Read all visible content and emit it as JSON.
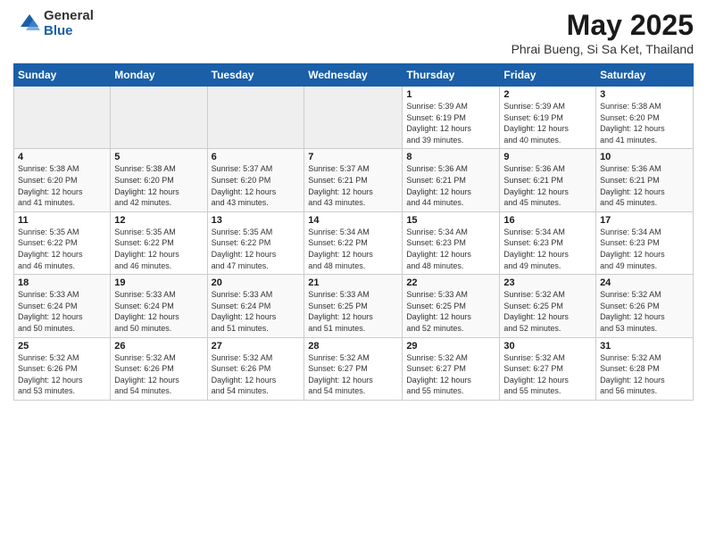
{
  "logo": {
    "general": "General",
    "blue": "Blue"
  },
  "header": {
    "title": "May 2025",
    "subtitle": "Phrai Bueng, Si Sa Ket, Thailand"
  },
  "weekdays": [
    "Sunday",
    "Monday",
    "Tuesday",
    "Wednesday",
    "Thursday",
    "Friday",
    "Saturday"
  ],
  "weeks": [
    [
      {
        "day": "",
        "info": ""
      },
      {
        "day": "",
        "info": ""
      },
      {
        "day": "",
        "info": ""
      },
      {
        "day": "",
        "info": ""
      },
      {
        "day": "1",
        "info": "Sunrise: 5:39 AM\nSunset: 6:19 PM\nDaylight: 12 hours\nand 39 minutes."
      },
      {
        "day": "2",
        "info": "Sunrise: 5:39 AM\nSunset: 6:19 PM\nDaylight: 12 hours\nand 40 minutes."
      },
      {
        "day": "3",
        "info": "Sunrise: 5:38 AM\nSunset: 6:20 PM\nDaylight: 12 hours\nand 41 minutes."
      }
    ],
    [
      {
        "day": "4",
        "info": "Sunrise: 5:38 AM\nSunset: 6:20 PM\nDaylight: 12 hours\nand 41 minutes."
      },
      {
        "day": "5",
        "info": "Sunrise: 5:38 AM\nSunset: 6:20 PM\nDaylight: 12 hours\nand 42 minutes."
      },
      {
        "day": "6",
        "info": "Sunrise: 5:37 AM\nSunset: 6:20 PM\nDaylight: 12 hours\nand 43 minutes."
      },
      {
        "day": "7",
        "info": "Sunrise: 5:37 AM\nSunset: 6:21 PM\nDaylight: 12 hours\nand 43 minutes."
      },
      {
        "day": "8",
        "info": "Sunrise: 5:36 AM\nSunset: 6:21 PM\nDaylight: 12 hours\nand 44 minutes."
      },
      {
        "day": "9",
        "info": "Sunrise: 5:36 AM\nSunset: 6:21 PM\nDaylight: 12 hours\nand 45 minutes."
      },
      {
        "day": "10",
        "info": "Sunrise: 5:36 AM\nSunset: 6:21 PM\nDaylight: 12 hours\nand 45 minutes."
      }
    ],
    [
      {
        "day": "11",
        "info": "Sunrise: 5:35 AM\nSunset: 6:22 PM\nDaylight: 12 hours\nand 46 minutes."
      },
      {
        "day": "12",
        "info": "Sunrise: 5:35 AM\nSunset: 6:22 PM\nDaylight: 12 hours\nand 46 minutes."
      },
      {
        "day": "13",
        "info": "Sunrise: 5:35 AM\nSunset: 6:22 PM\nDaylight: 12 hours\nand 47 minutes."
      },
      {
        "day": "14",
        "info": "Sunrise: 5:34 AM\nSunset: 6:22 PM\nDaylight: 12 hours\nand 48 minutes."
      },
      {
        "day": "15",
        "info": "Sunrise: 5:34 AM\nSunset: 6:23 PM\nDaylight: 12 hours\nand 48 minutes."
      },
      {
        "day": "16",
        "info": "Sunrise: 5:34 AM\nSunset: 6:23 PM\nDaylight: 12 hours\nand 49 minutes."
      },
      {
        "day": "17",
        "info": "Sunrise: 5:34 AM\nSunset: 6:23 PM\nDaylight: 12 hours\nand 49 minutes."
      }
    ],
    [
      {
        "day": "18",
        "info": "Sunrise: 5:33 AM\nSunset: 6:24 PM\nDaylight: 12 hours\nand 50 minutes."
      },
      {
        "day": "19",
        "info": "Sunrise: 5:33 AM\nSunset: 6:24 PM\nDaylight: 12 hours\nand 50 minutes."
      },
      {
        "day": "20",
        "info": "Sunrise: 5:33 AM\nSunset: 6:24 PM\nDaylight: 12 hours\nand 51 minutes."
      },
      {
        "day": "21",
        "info": "Sunrise: 5:33 AM\nSunset: 6:25 PM\nDaylight: 12 hours\nand 51 minutes."
      },
      {
        "day": "22",
        "info": "Sunrise: 5:33 AM\nSunset: 6:25 PM\nDaylight: 12 hours\nand 52 minutes."
      },
      {
        "day": "23",
        "info": "Sunrise: 5:32 AM\nSunset: 6:25 PM\nDaylight: 12 hours\nand 52 minutes."
      },
      {
        "day": "24",
        "info": "Sunrise: 5:32 AM\nSunset: 6:26 PM\nDaylight: 12 hours\nand 53 minutes."
      }
    ],
    [
      {
        "day": "25",
        "info": "Sunrise: 5:32 AM\nSunset: 6:26 PM\nDaylight: 12 hours\nand 53 minutes."
      },
      {
        "day": "26",
        "info": "Sunrise: 5:32 AM\nSunset: 6:26 PM\nDaylight: 12 hours\nand 54 minutes."
      },
      {
        "day": "27",
        "info": "Sunrise: 5:32 AM\nSunset: 6:26 PM\nDaylight: 12 hours\nand 54 minutes."
      },
      {
        "day": "28",
        "info": "Sunrise: 5:32 AM\nSunset: 6:27 PM\nDaylight: 12 hours\nand 54 minutes."
      },
      {
        "day": "29",
        "info": "Sunrise: 5:32 AM\nSunset: 6:27 PM\nDaylight: 12 hours\nand 55 minutes."
      },
      {
        "day": "30",
        "info": "Sunrise: 5:32 AM\nSunset: 6:27 PM\nDaylight: 12 hours\nand 55 minutes."
      },
      {
        "day": "31",
        "info": "Sunrise: 5:32 AM\nSunset: 6:28 PM\nDaylight: 12 hours\nand 56 minutes."
      }
    ]
  ]
}
